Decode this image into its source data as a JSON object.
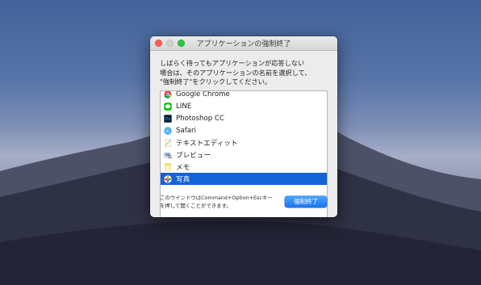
{
  "dialog": {
    "title": "アプリケーションの強制終了",
    "message_lines": [
      "しばらく待ってもアプリケーションが応答しない",
      "場合は、そのアプリケーションの名前を選択して、",
      "\"強制終了\"をクリックしてください。"
    ],
    "apps": [
      {
        "label": "Google Chrome",
        "icon": "chrome-icon"
      },
      {
        "label": "LINE",
        "icon": "line-icon"
      },
      {
        "label": "Photoshop CC",
        "icon": "photoshop-icon"
      },
      {
        "label": "Safari",
        "icon": "safari-icon"
      },
      {
        "label": "テキストエディット",
        "icon": "textedit-icon"
      },
      {
        "label": "プレビュー",
        "icon": "preview-icon"
      },
      {
        "label": "メモ",
        "icon": "notes-icon"
      },
      {
        "label": "写真",
        "icon": "photos-icon"
      }
    ],
    "selected_app": "写真",
    "footnote_lines": [
      "このウインドウはCommand+Option+Escキー",
      "を押して開くことができます。"
    ],
    "force_quit_label": "強制終了"
  },
  "colors": {
    "selection": "#1263d6",
    "button": "#1c74f2",
    "close": "#fc5f57",
    "zoom": "#2bc840"
  }
}
